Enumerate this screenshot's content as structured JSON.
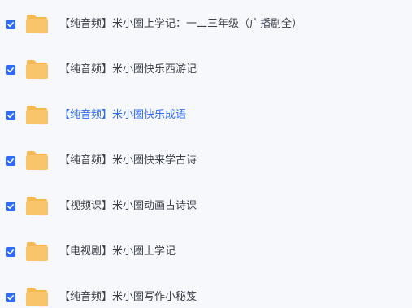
{
  "file_list": {
    "items": [
      {
        "name": "【纯音频】米小圈上学记：一二三年级（广播剧全）",
        "checked": true,
        "highlighted": false,
        "icon": "folder-icon"
      },
      {
        "name": "【纯音频】米小圈快乐西游记",
        "checked": true,
        "highlighted": false,
        "icon": "folder-icon"
      },
      {
        "name": "【纯音频】米小圈快乐成语",
        "checked": true,
        "highlighted": true,
        "icon": "folder-icon"
      },
      {
        "name": "【纯音频】米小圈快来学古诗",
        "checked": true,
        "highlighted": false,
        "icon": "folder-icon"
      },
      {
        "name": "【视频课】米小圈动画古诗课",
        "checked": true,
        "highlighted": false,
        "icon": "folder-icon"
      },
      {
        "name": "【电视剧】米小圈上学记",
        "checked": true,
        "highlighted": false,
        "icon": "folder-icon"
      },
      {
        "name": "【纯音频】米小圈写作小秘笈",
        "checked": true,
        "highlighted": false,
        "icon": "folder-icon"
      }
    ],
    "colors": {
      "checkbox": "#2f6cf6",
      "folder": "#f9c56b",
      "folder_tab": "#f5b952",
      "text": "#3b3f4a",
      "highlight_text": "#2f6cf6"
    }
  }
}
